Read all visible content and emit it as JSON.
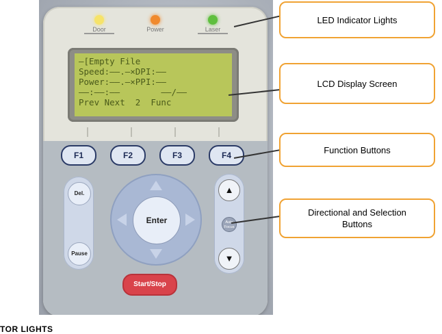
{
  "panel": {
    "leds": [
      {
        "label": "Door",
        "color": "#f6e36a"
      },
      {
        "label": "Power",
        "color": "#f08a2e"
      },
      {
        "label": "Laser",
        "color": "#5fbf3e"
      }
    ],
    "lcd_lines": [
      "—[Empty File",
      "Speed:——.—×DPI:——",
      "Power:——.—×PPI:——",
      "——:——:——        ——/——",
      "Prev Next  2  Func"
    ],
    "function_keys": [
      "F1",
      "F2",
      "F3",
      "F4"
    ],
    "del_label": "Del.",
    "pause_label": "Pause",
    "enter_label": "Enter",
    "up_arrow": "▲",
    "down_arrow": "▼",
    "auto_focus_label": "Auto Focus",
    "start_stop_label": "Start/Stop"
  },
  "callouts": [
    {
      "text": "LED Indicator Lights"
    },
    {
      "text": "LCD Display Screen"
    },
    {
      "text": "Function Buttons"
    },
    {
      "text": "Directional and Selection Buttons"
    }
  ],
  "caption": "TOR LIGHTS",
  "colors": {
    "callout_border": "#f0a232",
    "start_button": "#d9434b",
    "lcd_green": "#b8c65a"
  }
}
